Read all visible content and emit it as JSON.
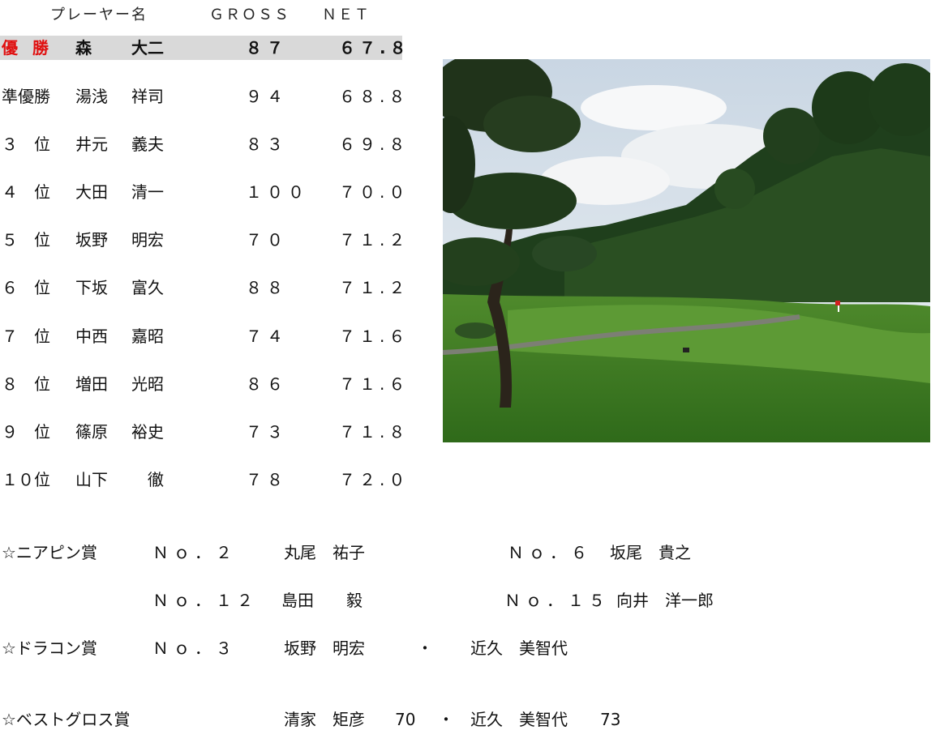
{
  "header": {
    "player_name": "プレーヤー名",
    "gross": "ＧＲＯＳＳ",
    "net": "ＮＥＴ"
  },
  "results": [
    {
      "rank": "優勝",
      "last": "森",
      "first": "大二",
      "gross": "８７",
      "net": "６７.８"
    },
    {
      "rank": "準優勝",
      "last": "湯浅",
      "first": "祥司",
      "gross": "９４",
      "net": "６８.８"
    },
    {
      "rank": "３　位",
      "last": "井元",
      "first": "義夫",
      "gross": "８３",
      "net": "６９.８"
    },
    {
      "rank": "４　位",
      "last": "大田",
      "first": "清一",
      "gross": "１００",
      "net": "７０.０"
    },
    {
      "rank": "５　位",
      "last": "坂野",
      "first": "明宏",
      "gross": "７０",
      "net": "７１.２"
    },
    {
      "rank": "６　位",
      "last": "下坂",
      "first": "富久",
      "gross": "８８",
      "net": "７１.２"
    },
    {
      "rank": "７　位",
      "last": "中西",
      "first": "嘉昭",
      "gross": "７４",
      "net": "７１.６"
    },
    {
      "rank": "８　位",
      "last": "増田",
      "first": "光昭",
      "gross": "８６",
      "net": "７１.６"
    },
    {
      "rank": "９　位",
      "last": "篠原",
      "first": "裕史",
      "gross": "７３",
      "net": "７１.８"
    },
    {
      "rank": "１０位",
      "last": "山下",
      "first": "　徹",
      "gross": "７８",
      "net": "７２.０"
    }
  ],
  "awards": {
    "nearpin": {
      "label": "☆ニアピン賞",
      "entries": [
        {
          "hole": "Ｎｏ．２",
          "name": "丸尾　祐子"
        },
        {
          "hole": "Ｎｏ．６",
          "name": "坂尾　貴之"
        },
        {
          "hole": "Ｎｏ．１２",
          "name": "島田　　毅"
        },
        {
          "hole": "Ｎｏ．１５",
          "name": "向井　洋一郎"
        }
      ]
    },
    "dracon": {
      "label": "☆ドラコン賞",
      "hole": "Ｎｏ．３",
      "name1": "坂野　明宏",
      "sep": "・",
      "name2": "近久　美智代"
    },
    "bestgross": {
      "label": "☆ベストグロス賞",
      "name1": "清家　矩彦",
      "score1": "70",
      "sep": "・",
      "name2": "近久　美智代",
      "score2": "73"
    }
  },
  "colors": {
    "winner_rank": "#e01010",
    "winner_row_bg": "#d9d9d9"
  }
}
